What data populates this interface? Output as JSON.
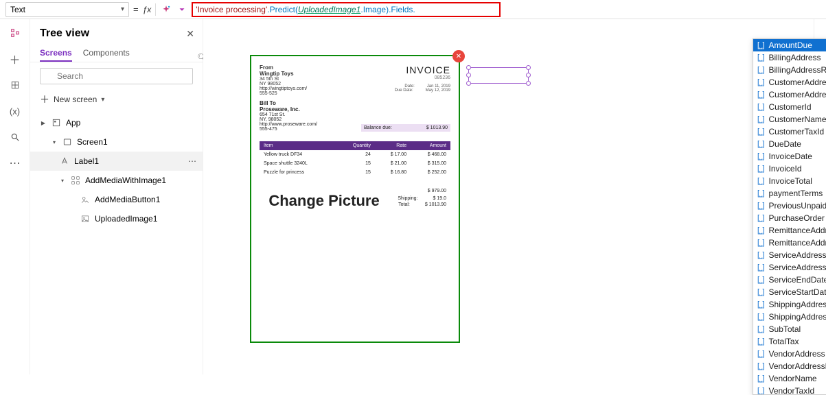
{
  "property_selector": {
    "value": "Text"
  },
  "formula": {
    "lit": "'Invoice processing'",
    "dot1": ".",
    "fn": "Predict",
    "open": "(",
    "ident": "UploadedImage1",
    "dot2": ".",
    "prop1": "Image",
    "close": ")",
    "dot3": ".",
    "prop2": "Fields",
    "dot4": "."
  },
  "tree": {
    "title": "Tree view",
    "tabs": {
      "screens": "Screens",
      "components": "Components"
    },
    "search_placeholder": "Search",
    "new_screen": "New screen",
    "nodes": {
      "app": "App",
      "screen1": "Screen1",
      "label1": "Label1",
      "addmedia": "AddMediaWithImage1",
      "addmediabtn": "AddMediaButton1",
      "uploaded": "UploadedImage1"
    }
  },
  "invoice": {
    "title": "INVOICE",
    "number": "085236",
    "from_label": "From",
    "from_name": "Wingtip Toys",
    "from_addr1": "34 5th St",
    "from_addr2": "NY 98052",
    "from_site": "http://wingtiptoys.com/",
    "from_phone": "555-525",
    "date_label": "Date:",
    "date_value": "Jan 11, 2019",
    "due_label": "Due Date:",
    "due_value": "May 12, 2019",
    "billto_label": "Bill To",
    "billto_name": "Proseware, Inc.",
    "billto_addr1": "654 71st St.",
    "billto_addr2": "NY, 98052",
    "billto_site": "http://www.proseware.com/",
    "billto_phone": "555-475",
    "balance_label": "Balance due:",
    "balance_value": "$ 1013.90",
    "headers": {
      "item": "Item",
      "qty": "Quantity",
      "rate": "Rate",
      "amount": "Amount"
    },
    "rows": [
      {
        "item": "Yellow truck DF34",
        "qty": "24",
        "rate": "$ 17.00",
        "amount": "$ 468.00"
      },
      {
        "item": "Space shuttle 3240L",
        "qty": "15",
        "rate": "$ 21.00",
        "amount": "$ 315.00"
      },
      {
        "item": "Puzzle for princess",
        "qty": "15",
        "rate": "$ 16.80",
        "amount": "$ 252.00"
      }
    ],
    "change_picture": "Change Picture",
    "totals": {
      "sub_v": "$ 979.00",
      "ship_l": "Shipping:",
      "ship_v": "$ 19.0",
      "tot_l": "Total:",
      "tot_v": "$ 1013.90"
    }
  },
  "intellisense": {
    "items": [
      "AmountDue",
      "BillingAddress",
      "BillingAddressRecipient",
      "CustomerAddress",
      "CustomerAddressRecipient",
      "CustomerId",
      "CustomerName",
      "CustomerTaxId",
      "DueDate",
      "InvoiceDate",
      "InvoiceId",
      "InvoiceTotal",
      "paymentTerms",
      "PreviousUnpaidBalance",
      "PurchaseOrder",
      "RemittanceAddress",
      "RemittanceAddressRecipient",
      "ServiceAddress",
      "ServiceAddressRecipient",
      "ServiceEndDate",
      "ServiceStartDate",
      "ShippingAddress",
      "ShippingAddressRecipient",
      "SubTotal",
      "TotalTax",
      "VendorAddress",
      "VendorAddressRecipient",
      "VendorName",
      "VendorTaxId"
    ],
    "selected_index": 0
  },
  "right_rail": {
    "marker": "a"
  }
}
